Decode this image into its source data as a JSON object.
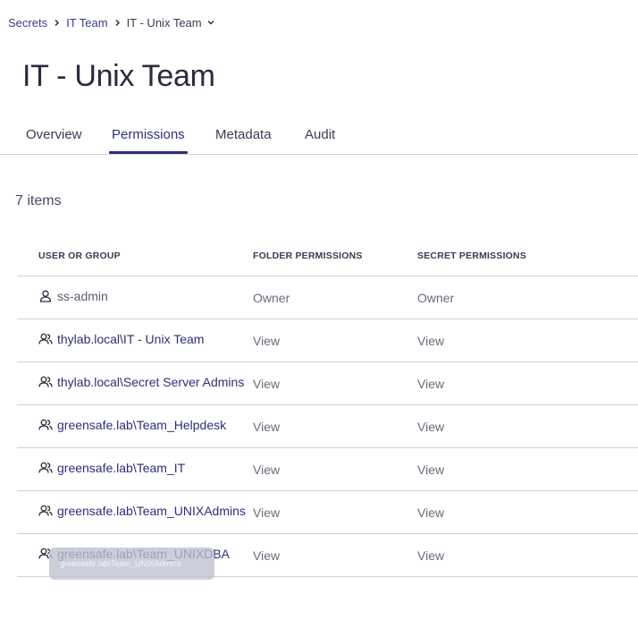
{
  "breadcrumb": {
    "items": [
      "Secrets",
      "IT Team",
      "IT - Unix Team"
    ]
  },
  "page": {
    "title": "IT - Unix Team",
    "item_count": "7 items"
  },
  "tabs": [
    {
      "label": "Overview",
      "active": false
    },
    {
      "label": "Permissions",
      "active": true
    },
    {
      "label": "Metadata",
      "active": false
    },
    {
      "label": "Audit",
      "active": false
    }
  ],
  "table": {
    "headers": [
      "USER OR GROUP",
      "FOLDER PERMISSIONS",
      "SECRET PERMISSIONS"
    ],
    "rows": [
      {
        "icon": "user-icon",
        "name": "ss-admin",
        "folder": "Owner",
        "secret": "Owner"
      },
      {
        "icon": "group-icon",
        "name": "thylab.local\\IT - Unix Team",
        "folder": "View",
        "secret": "View"
      },
      {
        "icon": "group-icon",
        "name": "thylab.local\\Secret Server Admins",
        "folder": "View",
        "secret": "View"
      },
      {
        "icon": "group-icon",
        "name": "greensafe.lab\\Team_Helpdesk",
        "folder": "View",
        "secret": "View"
      },
      {
        "icon": "group-icon",
        "name": "greensafe.lab\\Team_IT",
        "folder": "View",
        "secret": "View"
      },
      {
        "icon": "group-icon",
        "name": "greensafe.lab\\Team_UNIXAdmins",
        "folder": "View",
        "secret": "View"
      },
      {
        "icon": "group-icon",
        "name": "greensafe.lab\\Team_UNIXDBA",
        "folder": "View",
        "secret": "View"
      }
    ]
  },
  "tooltip": {
    "text": "greensafe.lab\\Team_UNIXAdmins"
  },
  "colors": {
    "accent": "#2f2e7f",
    "link": "#3a3a8f",
    "border": "#cfd0d8"
  }
}
